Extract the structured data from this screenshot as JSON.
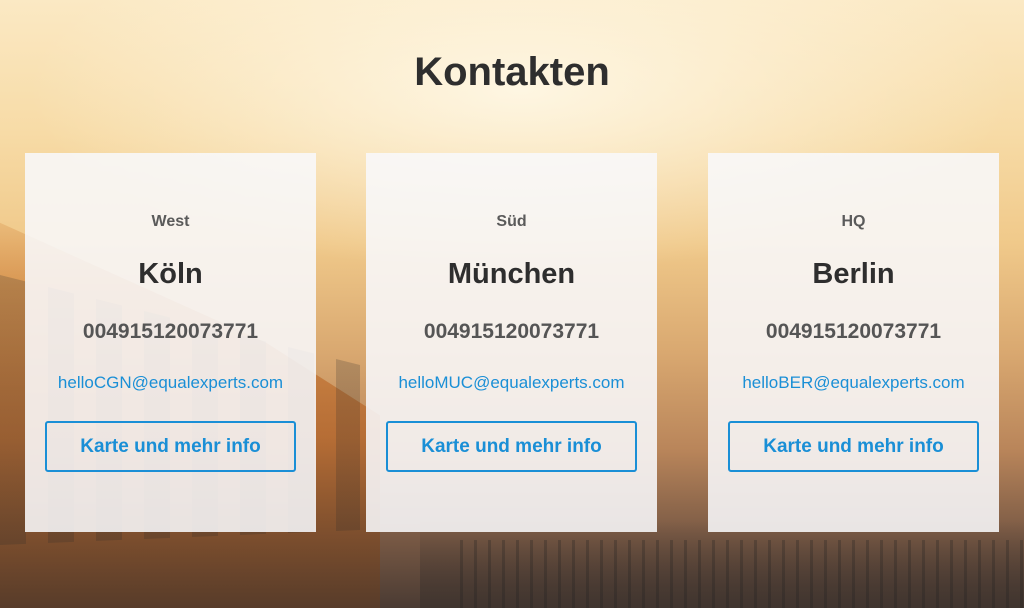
{
  "page": {
    "title": "Kontakten"
  },
  "colors": {
    "accent": "#1a8fd6",
    "title_text": "#2e2e2e",
    "card_background": "#f8f8fa"
  },
  "cards": [
    {
      "region": "West",
      "city": "Köln",
      "phone": "004915120073771",
      "email": "helloCGN@equalexperts.com",
      "button_label": "Karte und mehr info"
    },
    {
      "region": "Süd",
      "city": "München",
      "phone": "004915120073771",
      "email": "helloMUC@equalexperts.com",
      "button_label": "Karte und mehr info"
    },
    {
      "region": "HQ",
      "city": "Berlin",
      "phone": "004915120073771",
      "email": "helloBER@equalexperts.com",
      "button_label": "Karte und mehr info"
    }
  ]
}
